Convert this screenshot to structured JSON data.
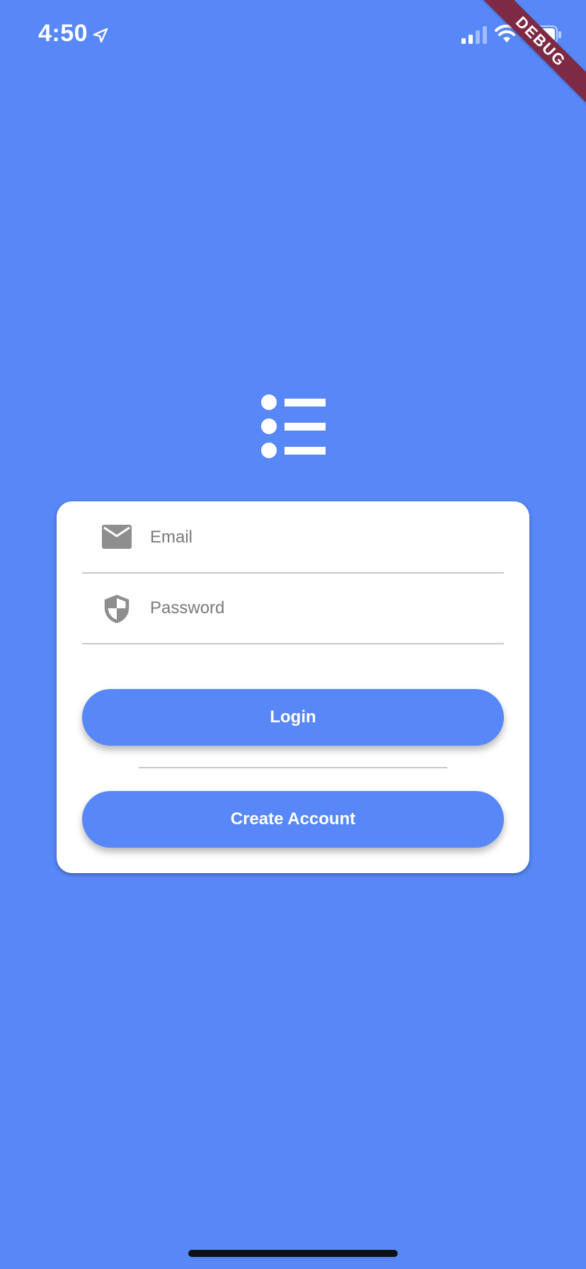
{
  "status_bar": {
    "time": "4:50"
  },
  "debug_banner": {
    "label": "DEBUG"
  },
  "login_form": {
    "email": {
      "placeholder": "Email",
      "value": ""
    },
    "password": {
      "placeholder": "Password",
      "value": ""
    },
    "login_label": "Login",
    "create_account_label": "Create Account"
  },
  "icons": {
    "logo": "list-icon",
    "email": "mail-icon",
    "password": "shield-icon"
  },
  "colors": {
    "background": "#5887F7",
    "button": "#5887F7",
    "card": "#FFFFFF",
    "icon": "#8E8E8E",
    "debug_ribbon": "#7E2A44"
  }
}
